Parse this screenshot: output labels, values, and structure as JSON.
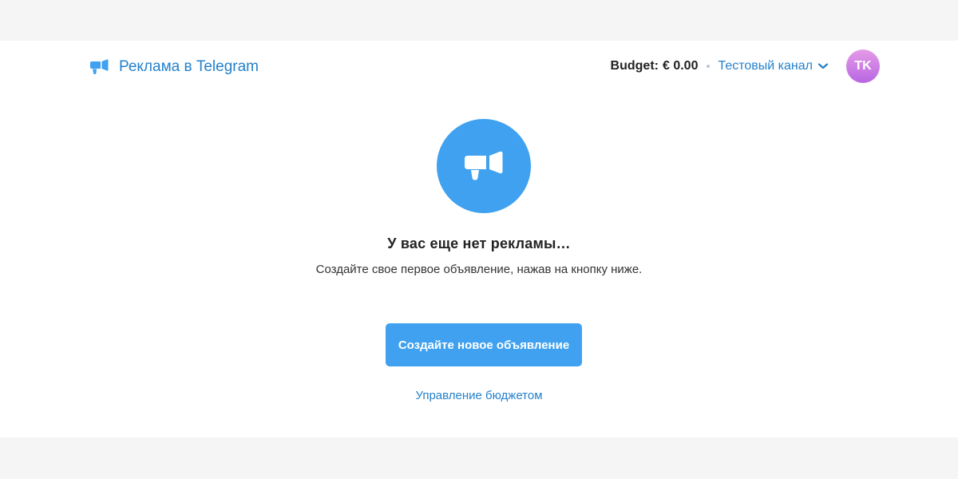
{
  "header": {
    "brand_title": "Реклама в Telegram",
    "budget_label": "Budget:",
    "budget_value": "€ 0.00",
    "channel_name": "Тестовый канал",
    "avatar_initials": "TK"
  },
  "empty_state": {
    "title": "У вас еще нет рекламы…",
    "subtitle": "Создайте свое первое объявление, нажав на кнопку ниже."
  },
  "actions": {
    "create_ad_label": "Создайте новое объявление",
    "manage_budget_label": "Управление бюджетом"
  },
  "icons": {
    "brand": "megaphone-icon",
    "hero": "megaphone-icon",
    "dropdown": "chevron-down-icon"
  },
  "colors": {
    "accent": "#3fa1ef",
    "link": "#2481cc",
    "avatar_from": "#e59be6",
    "avatar_to": "#b866e2",
    "page_background": "#f5f5f5"
  }
}
